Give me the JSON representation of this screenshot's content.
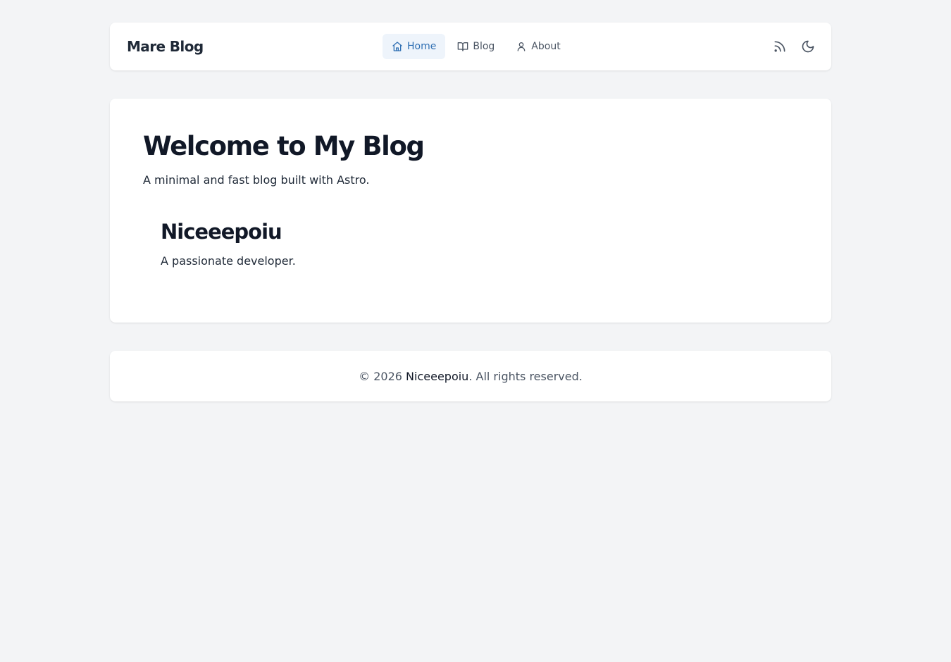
{
  "header": {
    "brand": "Mare Blog",
    "nav": [
      {
        "label": "Home",
        "icon": "home-icon",
        "active": true
      },
      {
        "label": "Blog",
        "icon": "book-icon",
        "active": false
      },
      {
        "label": "About",
        "icon": "user-icon",
        "active": false
      }
    ],
    "actions": [
      {
        "icon": "rss-icon"
      },
      {
        "icon": "moon-icon"
      }
    ]
  },
  "main": {
    "title": "Welcome to My Blog",
    "subtitle": "A minimal and fast blog built with Astro.",
    "author": {
      "name": "Niceeepoiu",
      "bio": "A passionate developer."
    }
  },
  "footer": {
    "prefix": "© 2026 ",
    "owner": "Niceeepoiu",
    "suffix": ". All rights reserved."
  },
  "colors": {
    "accent": "#2f6fb3",
    "active_bg": "#eef4fb",
    "page_bg": "#f3f4f6"
  }
}
